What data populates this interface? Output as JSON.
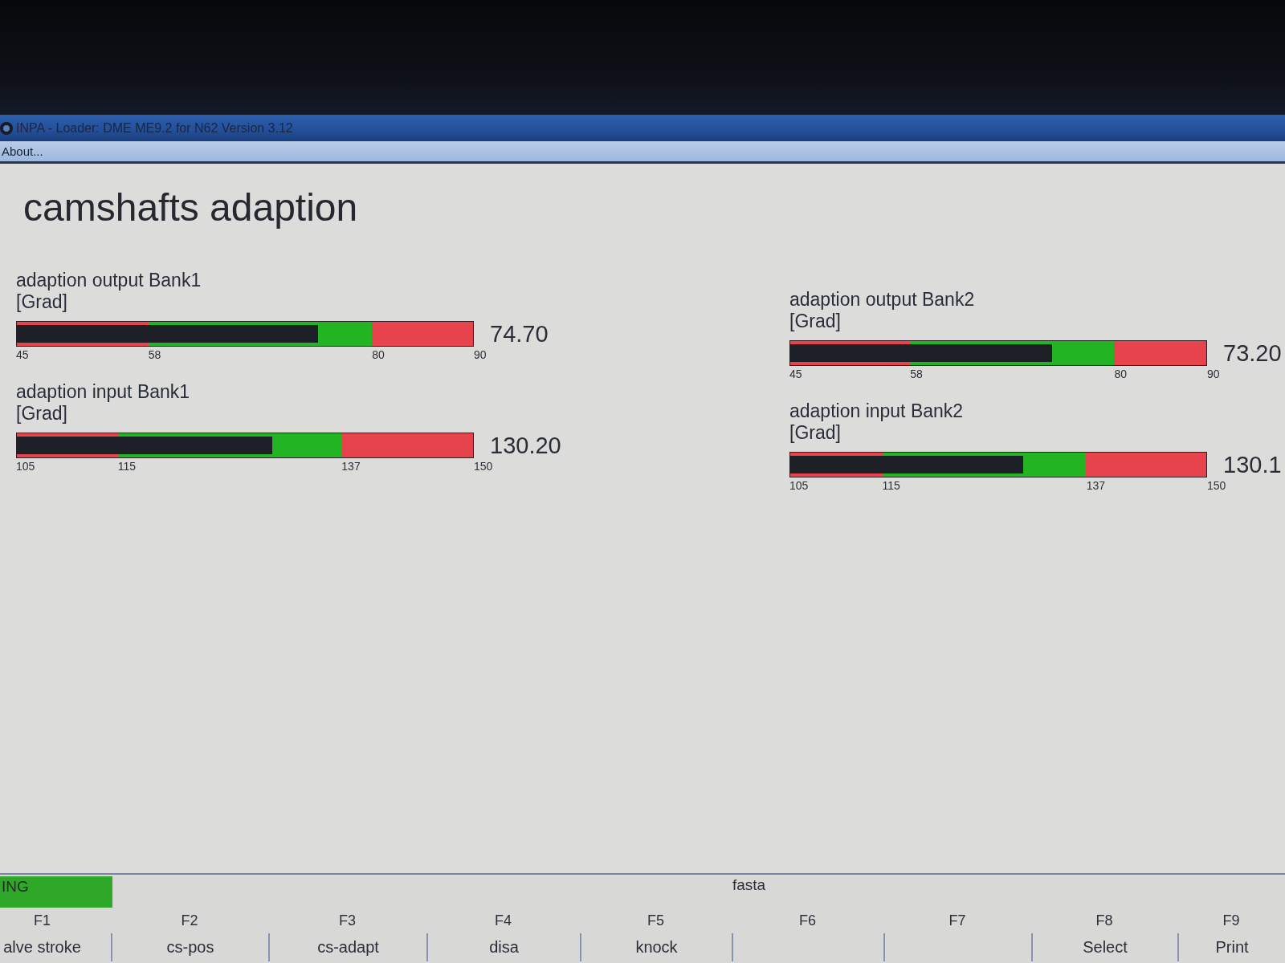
{
  "window": {
    "title": "INPA - Loader: DME ME9.2 for N62 Version 3.12",
    "menu": [
      "About..."
    ]
  },
  "page_title": "camshafts adaption",
  "columns": [
    {
      "gauges": [
        {
          "label": "adaption output Bank1",
          "unit": "[Grad]",
          "ticks": [
            "45",
            "58",
            "80",
            "90"
          ],
          "zones": [
            {
              "color": "#e6434c"
            },
            {
              "color": "#22b422"
            },
            {
              "color": "#e6434c"
            }
          ],
          "level": 0.66,
          "reading": "74.70"
        },
        {
          "label": "adaption input Bank1",
          "unit": "[Grad]",
          "ticks": [
            "105",
            "115",
            "137",
            "150"
          ],
          "zones": [
            {
              "color": "#e6434c"
            },
            {
              "color": "#22b422"
            },
            {
              "color": "#e6434c"
            }
          ],
          "level": 0.56,
          "reading": "130.20"
        }
      ]
    },
    {
      "gauges": [
        {
          "label": "adaption output Bank2",
          "unit": "[Grad]",
          "ticks": [
            "45",
            "58",
            "80",
            "90"
          ],
          "zones": [
            {
              "color": "#e6434c"
            },
            {
              "color": "#22b422"
            },
            {
              "color": "#e6434c"
            }
          ],
          "level": 0.63,
          "reading": "73.20"
        },
        {
          "label": "adaption input Bank2",
          "unit": "[Grad]",
          "ticks": [
            "105",
            "115",
            "137",
            "150"
          ],
          "zones": [
            {
              "color": "#e6434c"
            },
            {
              "color": "#22b422"
            },
            {
              "color": "#e6434c"
            }
          ],
          "level": 0.56,
          "reading": "130.1"
        }
      ]
    }
  ],
  "status_bar": {
    "state": "ING",
    "message": "fasta"
  },
  "function_keys": [
    {
      "key": "F1",
      "label": "alve stroke"
    },
    {
      "key": "F2",
      "label": "cs-pos"
    },
    {
      "key": "F3",
      "label": "cs-adapt"
    },
    {
      "key": "F4",
      "label": "disa"
    },
    {
      "key": "F5",
      "label": "knock"
    },
    {
      "key": "F6"
    },
    {
      "key": "F7"
    },
    {
      "key": "F8",
      "label": "Select"
    },
    {
      "key": "F9",
      "label": "Print"
    }
  ]
}
